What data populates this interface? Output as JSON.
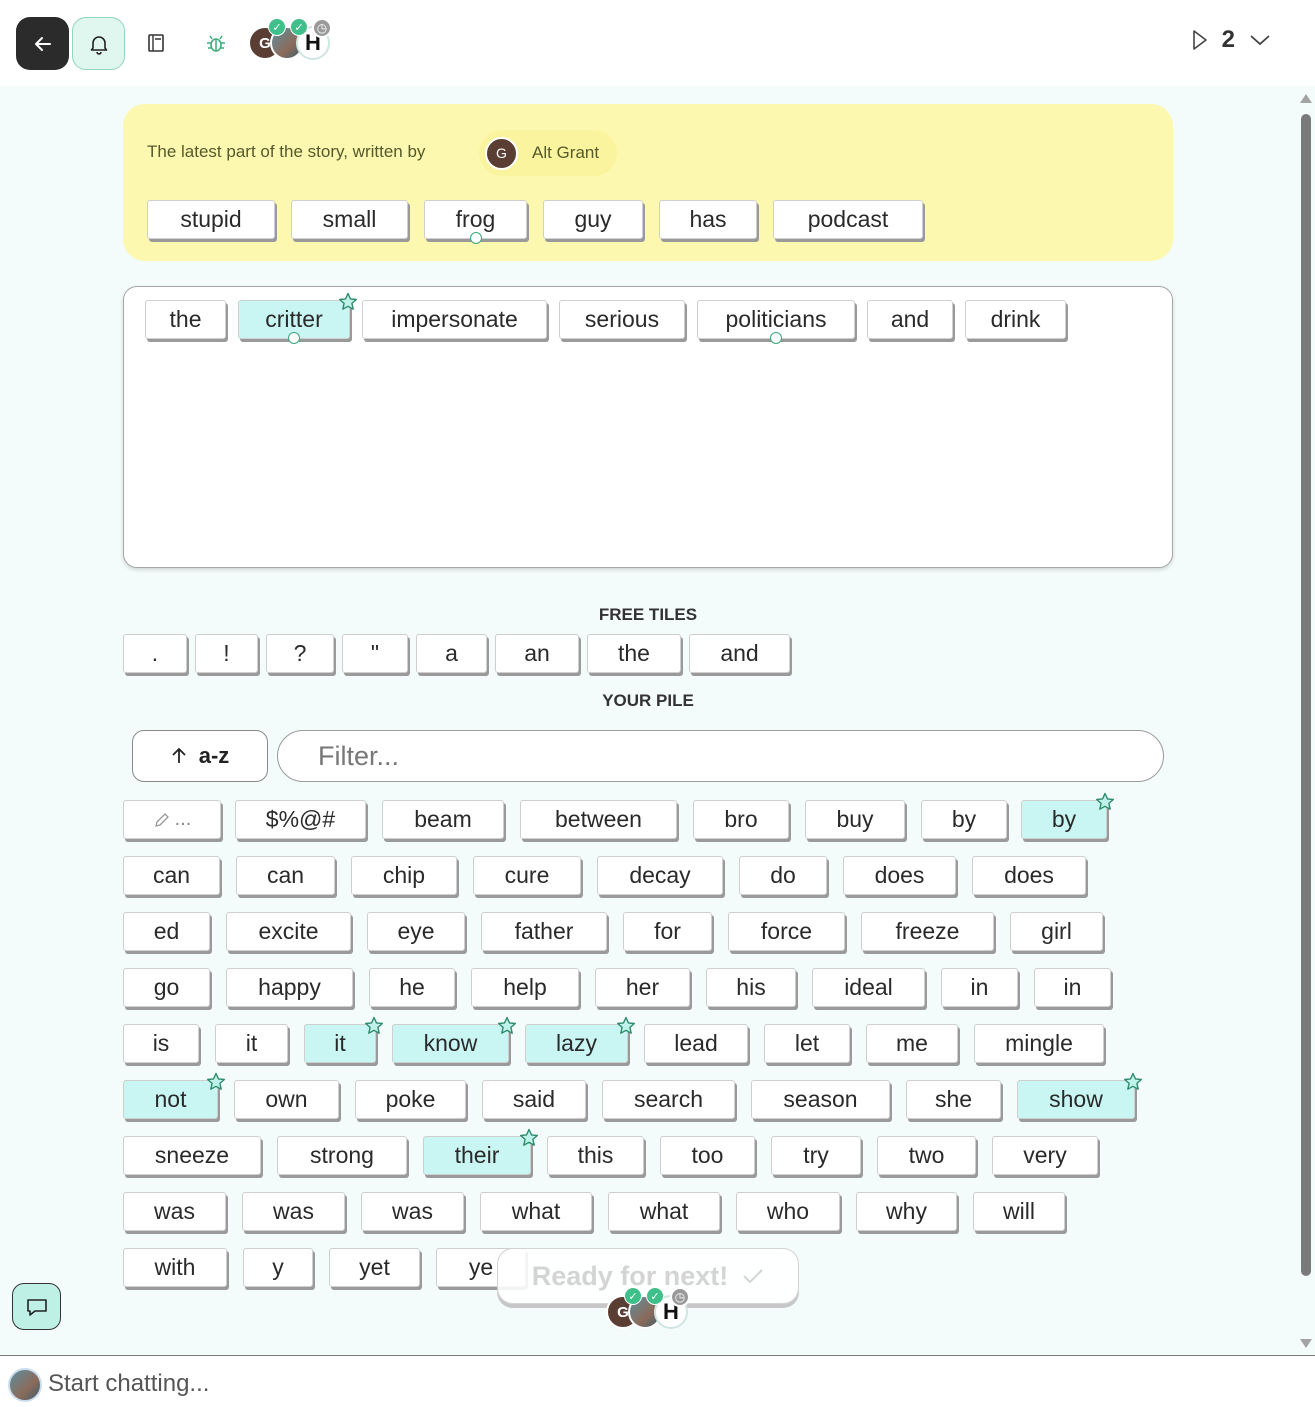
{
  "topbar": {
    "round_number": "2",
    "icons": [
      "back-arrow-icon",
      "bell-icon",
      "book-icon",
      "bug-icon",
      "play-icon",
      "chevron-down-icon"
    ],
    "players": [
      {
        "initial": "G",
        "status": "done"
      },
      {
        "initial": "",
        "status": "done"
      },
      {
        "initial": "H",
        "status": "waiting"
      }
    ]
  },
  "latest": {
    "intro": "The latest part of the story, written by",
    "author_initial": "G",
    "author_name": "Alt Grant",
    "words": [
      "stupid",
      "small",
      "frog",
      "guy",
      "has",
      "podcast"
    ]
  },
  "composer": {
    "words": [
      "the",
      "critter",
      "impersonate",
      "serious",
      "politicians",
      "and",
      "drink"
    ]
  },
  "free_tiles": {
    "label": "FREE TILES",
    "tiles": [
      ".",
      "!",
      "?",
      "\"",
      "a",
      "an",
      "the",
      "and"
    ]
  },
  "pile": {
    "label": "YOUR PILE",
    "sort_label": "a-z",
    "filter_placeholder": "Filter...",
    "edit_tile_label": "...",
    "rows": [
      [
        "$%@#",
        "beam",
        "between",
        "bro",
        "buy",
        "by",
        "by"
      ],
      [
        "can",
        "can",
        "chip",
        "cure",
        "decay",
        "do",
        "does",
        "does"
      ],
      [
        "ed",
        "excite",
        "eye",
        "father",
        "for",
        "force",
        "freeze",
        "girl"
      ],
      [
        "go",
        "happy",
        "he",
        "help",
        "her",
        "his",
        "ideal",
        "in",
        "in"
      ],
      [
        "is",
        "it",
        "it",
        "know",
        "lazy",
        "lead",
        "let",
        "me",
        "mingle"
      ],
      [
        "not",
        "own",
        "poke",
        "said",
        "search",
        "season",
        "she",
        "show"
      ],
      [
        "sneeze",
        "strong",
        "their",
        "this",
        "too",
        "try",
        "two",
        "very"
      ],
      [
        "was",
        "was",
        "was",
        "what",
        "what",
        "who",
        "why",
        "will"
      ],
      [
        "with",
        "y",
        "yet",
        "ye"
      ]
    ]
  },
  "ready": {
    "label": "Ready for next!"
  },
  "chat": {
    "placeholder": "Start chatting..."
  },
  "colors": {
    "highlight_tile": "#c9f6f3",
    "latest_bg": "#fdf8b0",
    "accent_green": "#3fbf8a"
  }
}
